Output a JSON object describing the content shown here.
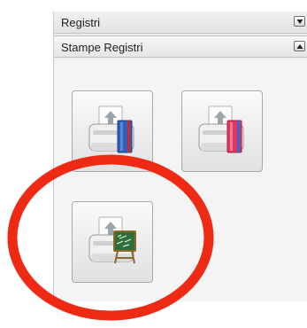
{
  "panel": {
    "sections": [
      {
        "label": "Registri",
        "toggle_icon": "chevron-down-icon"
      },
      {
        "label": "Stampe Registri",
        "toggle_icon": "chevron-up-icon"
      }
    ],
    "buttons": [
      {
        "icon": "printer-blue-book-icon",
        "accent": "#2f5fb8"
      },
      {
        "icon": "printer-red-book-icon",
        "accent": "#d9334a"
      },
      {
        "icon": "printer-blackboard-icon",
        "accent": "#2f6e3a"
      }
    ]
  },
  "annotation": {
    "color": "#ee2a15"
  }
}
